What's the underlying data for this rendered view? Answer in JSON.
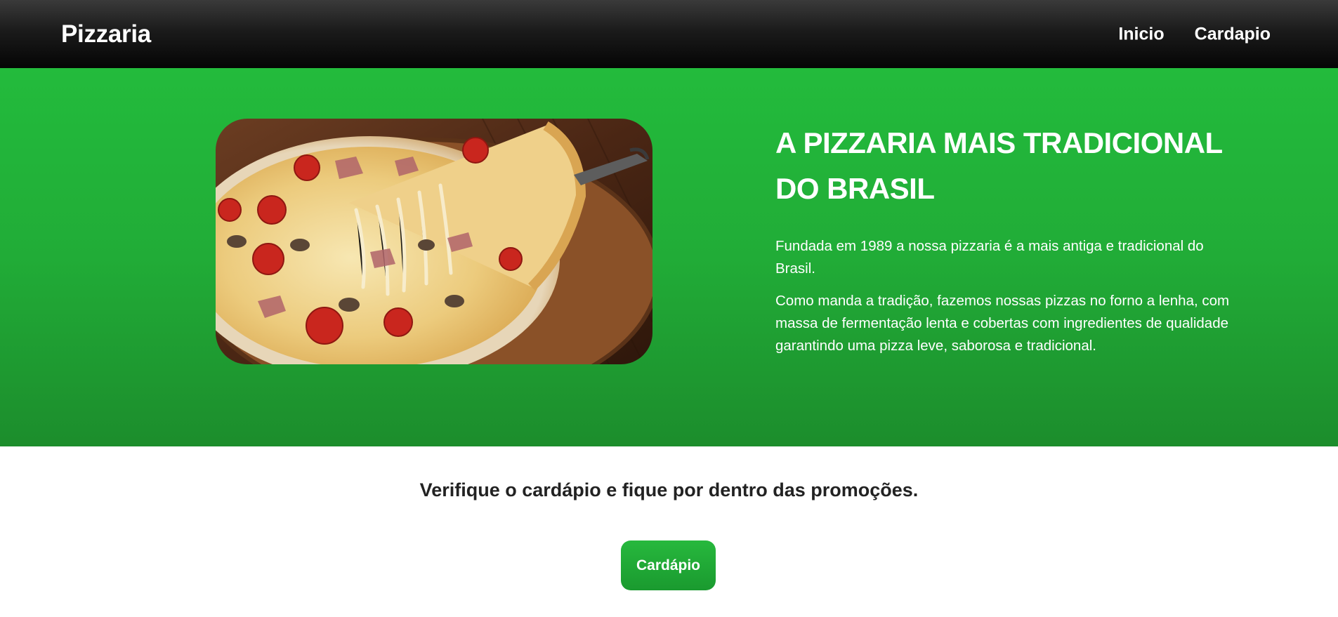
{
  "nav": {
    "brand": "Pizzaria",
    "links": [
      "Inicio",
      "Cardapio"
    ]
  },
  "hero": {
    "image_alt": "pizza",
    "title": "A PIZZARIA MAIS TRADICIONAL DO BRASIL",
    "paragraphs": [
      "Fundada em 1989 a nossa pizzaria é a mais antiga e tradicional do Brasil.",
      "Como manda a tradição, fazemos nossas pizzas no forno a lenha, com massa de fermentação lenta e cobertas com ingredientes de qualidade garantindo uma pizza leve, saborosa e tradicional."
    ]
  },
  "cta": {
    "heading": "Verifique o cardápio e fique por dentro das promoções.",
    "button_label": "Cardápio"
  },
  "colors": {
    "hero_green": "#22b33a",
    "navbar_black": "#111111",
    "button_green": "#1fa634"
  },
  "icons": {
    "pizza_image": "pizza-photo"
  }
}
